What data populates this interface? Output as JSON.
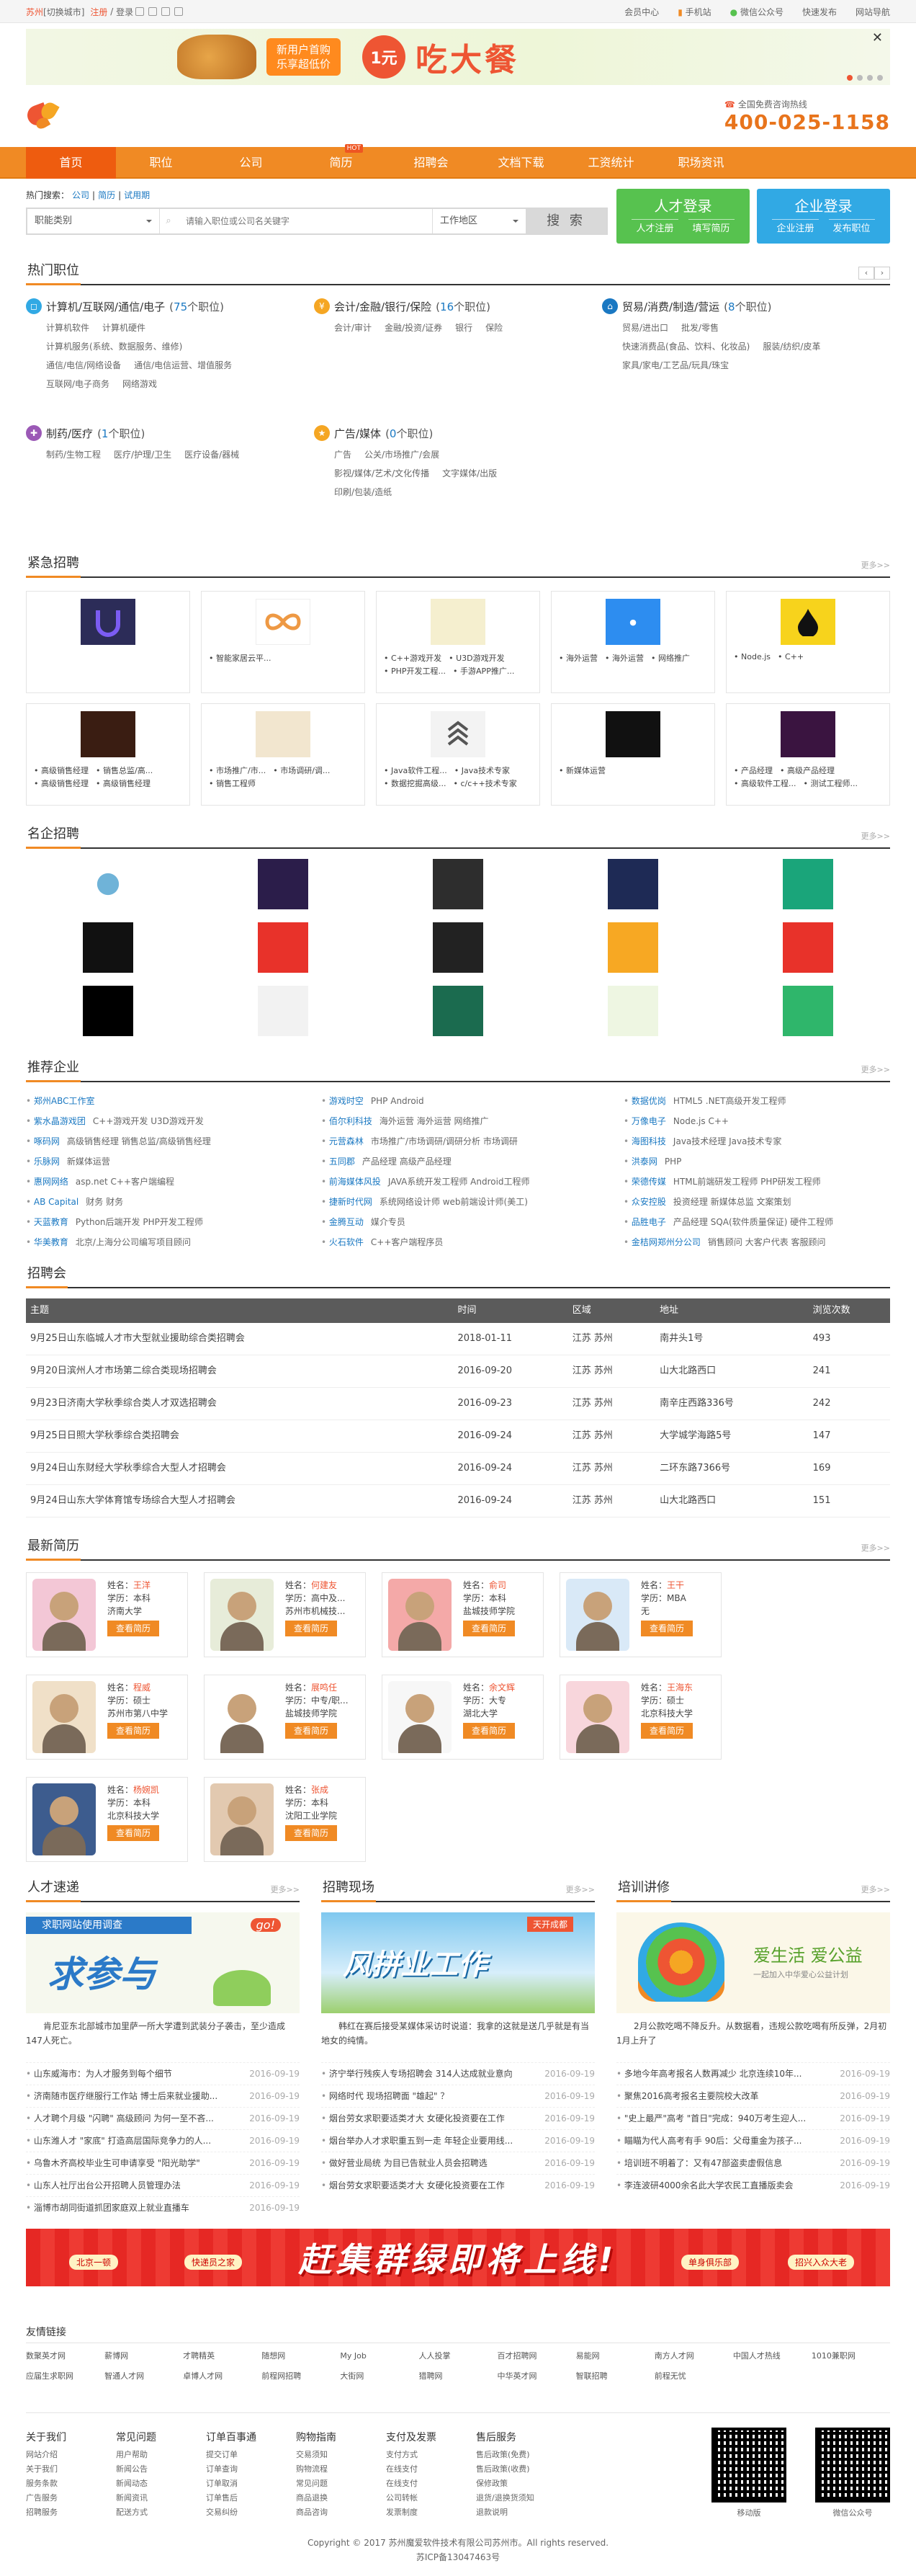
{
  "topbar": {
    "city": "苏州",
    "switch": "[切换城市]",
    "register": "注册",
    "login": "登录",
    "user_center": "会员中心",
    "mobile": "手机站",
    "wechat": "微信公众号",
    "nav_quick": "快速发布",
    "site_nav": "网站导航"
  },
  "ad_top": {
    "tag1": "新用户首购",
    "tag2": "乐享超低价",
    "price": "1元",
    "text": "吃大餐"
  },
  "header": {
    "hotline_label": "全国免费咨询热线",
    "hotline": "400-025-1158"
  },
  "nav": [
    "首页",
    "职位",
    "公司",
    "简历",
    "招聘会",
    "文档下载",
    "工资统计",
    "职场资讯"
  ],
  "nav_hot": "HOT",
  "search": {
    "hot_label": "热门搜索：",
    "hot": [
      "公司",
      "简历",
      "试用期"
    ],
    "category": "职能类别",
    "placeholder": "请输入职位或公司名关键字",
    "area": "工作地区",
    "button": "搜 索"
  },
  "login_talent": {
    "title": "人才登录",
    "a": "人才注册",
    "b": "填写简历"
  },
  "login_company": {
    "title": "企业登录",
    "a": "企业注册",
    "b": "发布职位"
  },
  "sections": {
    "hotjobs": "热门职位",
    "urgent": "紧急招聘",
    "famous": "名企招聘",
    "recommend": "推荐企业",
    "fair": "招聘会",
    "resumes": "最新简历",
    "speed": "人才速递",
    "scene": "招聘现场",
    "training": "培训讲修",
    "more": "更多>>"
  },
  "hotjobs": [
    {
      "name": "计算机/互联网/通信/电子",
      "count": "75",
      "rows": [
        [
          "计算机软件",
          "计算机硬件"
        ],
        [
          "计算机服务(系统、数据服务、维修)"
        ],
        [
          "通信/电信/网络设备",
          "通信/电信运营、增值服务"
        ],
        [
          "互联网/电子商务",
          "网络游戏"
        ]
      ]
    },
    {
      "name": "会计/金融/银行/保险",
      "count": "16",
      "rows": [
        [
          "会计/审计",
          "金融/投资/证券",
          "银行",
          "保险"
        ]
      ]
    },
    {
      "name": "贸易/消费/制造/营运",
      "count": "8",
      "rows": [
        [
          "贸易/进出口",
          "批发/零售"
        ],
        [
          "快速消费品(食品、饮料、化妆品)",
          "服装/纺织/皮革"
        ],
        [
          "家具/家电/工艺品/玩具/珠宝"
        ]
      ]
    },
    {
      "name": "制药/医疗",
      "count": "1",
      "rows": [
        [
          "制药/生物工程",
          "医疗/护理/卫生",
          "医疗设备/器械"
        ]
      ]
    },
    {
      "name": "广告/媒体",
      "count": "0",
      "rows": [
        [
          "广告",
          "公关/市场推广/会展"
        ],
        [
          "影视/媒体/艺术/文化传播",
          "文字媒体/出版"
        ],
        [
          "印刷/包装/造纸"
        ]
      ]
    }
  ],
  "hotjobs_count_fmt": [
    "(",
    "个职位)"
  ],
  "urgent": [
    {
      "jobs": []
    },
    {
      "jobs": [
        "智能家居云平..."
      ]
    },
    {
      "jobs": [
        "C++游戏开发",
        "U3D游戏开发",
        "PHP开发工程...",
        "手游APP推广..."
      ]
    },
    {
      "jobs": [
        "海外运营",
        "海外运营",
        "网络推广"
      ]
    },
    {
      "jobs": [
        "Node.js",
        "C++"
      ]
    },
    {
      "jobs": [
        "高级销售经理",
        "销售总监/高...",
        "高级销售经理",
        "高级销售经理"
      ]
    },
    {
      "jobs": [
        "市场推广/市...",
        "市场调研/调...",
        "销售工程师"
      ]
    },
    {
      "jobs": [
        "Java软件工程...",
        "Java技术专家",
        "数据挖掘高级...",
        "c/c++技术专家"
      ]
    },
    {
      "jobs": [
        "新媒体运营"
      ]
    },
    {
      "jobs": [
        "产品经理",
        "高级产品经理",
        "高级软件工程...",
        "测试工程师..."
      ]
    }
  ],
  "recommend": [
    [
      "郑州ABC工作室",
      ""
    ],
    [
      "游戏时空",
      "PHP  Android"
    ],
    [
      "数据优岗",
      "HTML5 .NET高级开发工程师"
    ],
    [
      "紫水晶游戏团",
      "C++游戏开发  U3D游戏开发"
    ],
    [
      "佰尔利科技",
      "海外运营  海外运营  网络推广"
    ],
    [
      "万像电子",
      "Node.js  C++"
    ],
    [
      "啄码网",
      "高级销售经理  销售总监/高级销售经理"
    ],
    [
      "元营森林",
      "市场推广/市场调研/调研分析  市场调研"
    ],
    [
      "海图科技",
      "Java技术经理  Java技术专家"
    ],
    [
      "乐脉网",
      "新媒体运营"
    ],
    [
      "五同郡",
      "产品经理  高级产品经理"
    ],
    [
      "洪泰网",
      "PHP"
    ],
    [
      "惠网网络",
      "asp.net  C++客户端编程"
    ],
    [
      "前海媒体风投",
      "JAVA系统开发工程师  Android工程师"
    ],
    [
      "荣德传媒",
      "HTML前端研发工程师  PHP研发工程师"
    ],
    [
      "AB Capital",
      "财务  财务"
    ],
    [
      "捷新时代网",
      "系统网络设计师  web前端设计师(美工)"
    ],
    [
      "众安控股",
      "投资经理  新媒体总监  文案策划"
    ],
    [
      "天蓝教育",
      "Python后端开发  PHP开发工程师"
    ],
    [
      "金腾互动",
      "媒介专员"
    ],
    [
      "品胜电子",
      "产品经理  SQA(软件质量保证)  硬件工程师"
    ],
    [
      "华美教育",
      "北京/上海分公司编写项目顾问"
    ],
    [
      "火石软件",
      "C++客户端程序员"
    ],
    [
      "金桔网郑州分公司",
      "销售顾问  大客户代表  客服顾问"
    ]
  ],
  "fair": {
    "headers": [
      "主题",
      "时间",
      "区域",
      "地址",
      "浏览次数"
    ],
    "rows": [
      [
        "9月25日山东临城人才市大型就业援助综合类招聘会",
        "2018-01-11",
        "江苏 苏州",
        "南井头1号",
        "493"
      ],
      [
        "9月20日滨州人才市场第二综合类现场招聘会",
        "2016-09-20",
        "江苏 苏州",
        "山大北路西口",
        "241"
      ],
      [
        "9月23日济南大学秋季综合类人才双选招聘会",
        "2016-09-23",
        "江苏 苏州",
        "南辛庄西路336号",
        "242"
      ],
      [
        "9月25日日照大学秋季综合类招聘会",
        "2016-09-24",
        "江苏 苏州",
        "大学城学海路5号",
        "147"
      ],
      [
        "9月24日山东财经大学秋季综合大型人才招聘会",
        "2016-09-24",
        "江苏 苏州",
        "二环东路7366号",
        "169"
      ],
      [
        "9月24日山东大学体育馆专场综合大型人才招聘会",
        "2016-09-24",
        "江苏 苏州",
        "山大北路西口",
        "151"
      ]
    ]
  },
  "resume_labels": {
    "name": "姓名：",
    "edu": "学历：",
    "btn": "查看简历"
  },
  "resumes": [
    {
      "name": "王洋",
      "edu": "本科",
      "school": "济南大学"
    },
    {
      "name": "何建友",
      "edu": "高中及...",
      "school": "苏州市机械技..."
    },
    {
      "name": "俞司",
      "edu": "本科",
      "school": "盐城技师学院"
    },
    {
      "name": "王干",
      "edu": "MBA",
      "school": "无"
    },
    {
      "name": "程威",
      "edu": "硕士",
      "school": "苏州市第八中学"
    },
    {
      "name": "展鸣任",
      "edu": "中专/职...",
      "school": "盐城技师学院"
    },
    {
      "name": "余文辉",
      "edu": "大专",
      "school": "湖北大学"
    },
    {
      "name": "王海东",
      "edu": "硕士",
      "school": "北京科技大学"
    },
    {
      "name": "杨婉凯",
      "edu": "本科",
      "school": "北京科技大学"
    },
    {
      "name": "张成",
      "edu": "本科",
      "school": "沈阳工业学院"
    }
  ],
  "speed": {
    "pic": "求参与",
    "sub": "求职网站使用调查",
    "go": "go!",
    "desc": "肯尼亚东北部城市加里萨一所大学遭到武装分子袭击，至少造成147人死亡。",
    "items": [
      [
        "山东威海市：为人才服务到每个细节",
        "2016-09-19"
      ],
      [
        "济南随市医疗继服行工作站 博士后来就业援助...",
        "2016-09-19"
      ],
      [
        "人才聘个月级 \"闪聘\" 高级顾问 为何一至不吝...",
        "2016-09-19"
      ],
      [
        "山东潍人才 \"家底\" 打造高层国际竞争力的人...",
        "2016-09-19"
      ],
      [
        "乌鲁木齐高校毕业生可申请享受 \"阳光助学\"",
        "2016-09-19"
      ],
      [
        "山东人社厅出台公开招聘人员管理办法",
        "2016-09-19"
      ],
      [
        "淄博市胡同街道抓团家庭双上就业直播车",
        "2016-09-19"
      ]
    ]
  },
  "scene": {
    "pic": "风拼业工作",
    "sub": "天开成都",
    "desc": "韩红在赛后接受某媒体采访时说道：我拿的这就是送几乎就是有当地女的纯情。",
    "items": [
      [
        "济宁举行残疾人专场招聘会 314人达成就业意向",
        "2016-09-19"
      ],
      [
        "网络时代 现场招聘面 \"雄起\" ？",
        "2016-09-19"
      ],
      [
        "烟台劳女求职要适类才大 女硬化投资要在工作",
        "2016-09-19"
      ],
      [
        "烟台举办人才求职重五到一走 年轻企业要用线...",
        "2016-09-19"
      ],
      [
        "做好营业局统 为目已告就业人员会招聘选",
        "2016-09-19"
      ],
      [
        "烟台劳女求职要适类才大 女硬化投资要在工作",
        "2016-09-19"
      ]
    ]
  },
  "training": {
    "pic": "爱生活 爱公益",
    "sub": "一起加入中华爱心公益计划",
    "desc": "2月公款吃喝不降反升。从数据看，违规公款吃喝有所反弹，2月初1月上升了",
    "items": [
      [
        "多地今年高考报名人数再减少 北京连续10年...",
        "2016-09-19"
      ],
      [
        "聚焦2016高考报名主要院校大改革",
        "2016-09-19"
      ],
      [
        "\"史上最严\"高考 \"首日\"完成：940万考生迎人...",
        "2016-09-19"
      ],
      [
        "瞄瞄为代人高考有手 90后：父母重金为孩子...",
        "2016-09-19"
      ],
      [
        "培训班不明着了：又有47部盗卖虚假信息",
        "2016-09-19"
      ],
      [
        "李连波研4000余名此大学农民工直播版卖会",
        "2016-09-19"
      ]
    ]
  },
  "banner2": {
    "text": "赶集群绿即将上线!",
    "pills": [
      "北京一顿",
      "快递员之家",
      "单身俱乐部",
      "招兴入众大老"
    ]
  },
  "links": {
    "title": "友情链接",
    "items": [
      "数聚英才网",
      "薪博网",
      "才聘精英",
      "随想网",
      "My Job",
      "人人投掌",
      "百才招聘网",
      "易能网",
      "南方人才网",
      "中国人才热线",
      "1010兼职网",
      "应届生求职网",
      "智通人才网",
      "卓博人才网",
      "前程网招聘",
      "大街网",
      "猎聘网",
      "中华英才网",
      "智联招聘",
      "前程无忧"
    ]
  },
  "footer": [
    {
      "h": "关于我们",
      "items": [
        "网站介绍",
        "关于我们",
        "服务条款",
        "广告服务",
        "招聘服务"
      ]
    },
    {
      "h": "常见问题",
      "items": [
        "用户帮助",
        "新闻公告",
        "新闻动态",
        "新闻资讯",
        "配送方式"
      ]
    },
    {
      "h": "订单百事通",
      "items": [
        "提交订单",
        "订单查询",
        "订单取消",
        "订单售后",
        "交易纠纷"
      ]
    },
    {
      "h": "购物指南",
      "items": [
        "交易须知",
        "购物流程",
        "常见问题",
        "商品退换",
        "商品咨询"
      ]
    },
    {
      "h": "支付及发票",
      "items": [
        "支付方式",
        "在线支付",
        "在线支付",
        "公司转帐",
        "发票制度"
      ]
    },
    {
      "h": "售后服务",
      "items": [
        "售后政策(免费)",
        "售后政策(收费)",
        "保修政策",
        "退货/退换货须知",
        "退款说明"
      ]
    }
  ],
  "qr": [
    "移动版",
    "微信公众号"
  ],
  "copyright": "Copyright © 2017 苏州魔爱软件技术有限公司苏州市。All rights reserved.",
  "icp": "苏ICP备13047463号",
  "colors": {
    "accent": "#f08a24",
    "link": "#1a78c2",
    "green": "#57c24f",
    "blue": "#31a9e4"
  }
}
